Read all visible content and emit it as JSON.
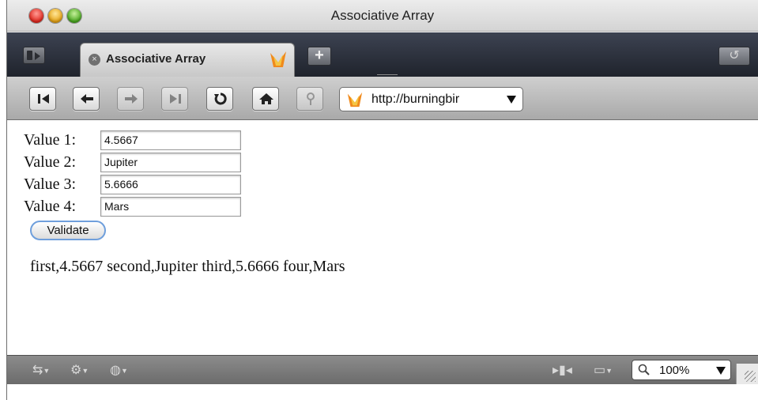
{
  "window": {
    "title": "Associative Array"
  },
  "tabs": [
    {
      "label": "Associative Array",
      "close_glyph": "×"
    }
  ],
  "tabbar": {
    "new_tab_glyph": "+",
    "reopen_glyph": "↺"
  },
  "toolbar": {
    "buttons": [
      "first-page-icon",
      "back-icon",
      "forward-icon",
      "last-page-icon",
      "reload-icon",
      "home-icon",
      "bookmark-icon"
    ],
    "address": "http://burningbir"
  },
  "form": {
    "fields": [
      {
        "label": "Value 1:",
        "value": "4.5667"
      },
      {
        "label": "Value 2:",
        "value": "Jupiter"
      },
      {
        "label": "Value 3:",
        "value": "5.6666"
      },
      {
        "label": "Value 4:",
        "value": "Mars"
      }
    ],
    "validate_label": "Validate"
  },
  "output": {
    "text": "first,4.5667 second,Jupiter third,5.6666 four,Mars"
  },
  "statusbar": {
    "zoom": "100%"
  },
  "colors": {
    "tab_bar": "#1f232c",
    "validate_focus_ring": "#6f9fdc"
  }
}
